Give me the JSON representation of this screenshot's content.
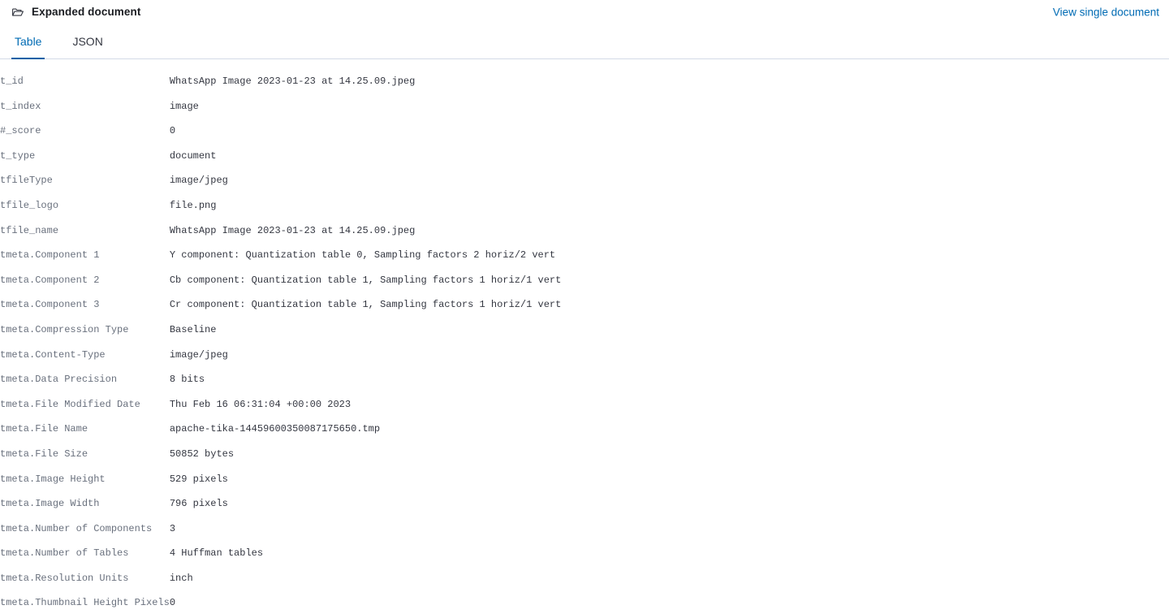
{
  "header": {
    "title": "Expanded document",
    "folder_icon": "folder-open-icon",
    "link_label": "View single document"
  },
  "tabs": [
    {
      "label": "Table",
      "active": true
    },
    {
      "label": "JSON",
      "active": false
    }
  ],
  "accent_colors": {
    "link": "#006bb4",
    "active_tab_underline": "#0061a6",
    "field_label": "#69707d",
    "value_text": "#343741",
    "tab_border": "#d3dae6"
  },
  "table": {
    "rows": [
      {
        "type": "t",
        "field": "_id",
        "value": "WhatsApp Image 2023-01-23 at 14.25.09.jpeg"
      },
      {
        "type": "t",
        "field": "_index",
        "value": "image"
      },
      {
        "type": "#",
        "field": "_score",
        "value": "0"
      },
      {
        "type": "t",
        "field": "_type",
        "value": "document"
      },
      {
        "type": "t",
        "field": "fileType",
        "value": "image/jpeg"
      },
      {
        "type": "t",
        "field": "file_logo",
        "value": "file.png"
      },
      {
        "type": "t",
        "field": "file_name",
        "value": "WhatsApp Image 2023-01-23 at 14.25.09.jpeg"
      },
      {
        "type": "t",
        "field": "meta.Component 1",
        "value": "Y component: Quantization table 0, Sampling factors 2 horiz/2 vert"
      },
      {
        "type": "t",
        "field": "meta.Component 2",
        "value": "Cb component: Quantization table 1, Sampling factors 1 horiz/1 vert"
      },
      {
        "type": "t",
        "field": "meta.Component 3",
        "value": "Cr component: Quantization table 1, Sampling factors 1 horiz/1 vert"
      },
      {
        "type": "t",
        "field": "meta.Compression Type",
        "value": "Baseline"
      },
      {
        "type": "t",
        "field": "meta.Content-Type",
        "value": "image/jpeg"
      },
      {
        "type": "t",
        "field": "meta.Data Precision",
        "value": "8 bits"
      },
      {
        "type": "t",
        "field": "meta.File Modified Date",
        "value": "Thu Feb 16 06:31:04 +00:00 2023"
      },
      {
        "type": "t",
        "field": "meta.File Name",
        "value": "apache-tika-14459600350087175650.tmp"
      },
      {
        "type": "t",
        "field": "meta.File Size",
        "value": "50852 bytes"
      },
      {
        "type": "t",
        "field": "meta.Image Height",
        "value": "529 pixels"
      },
      {
        "type": "t",
        "field": "meta.Image Width",
        "value": "796 pixels"
      },
      {
        "type": "t",
        "field": "meta.Number of Components",
        "value": "3"
      },
      {
        "type": "t",
        "field": "meta.Number of Tables",
        "value": "4 Huffman tables"
      },
      {
        "type": "t",
        "field": "meta.Resolution Units",
        "value": "inch"
      },
      {
        "type": "t",
        "field": "meta.Thumbnail Height Pixels",
        "value": "0"
      }
    ]
  }
}
